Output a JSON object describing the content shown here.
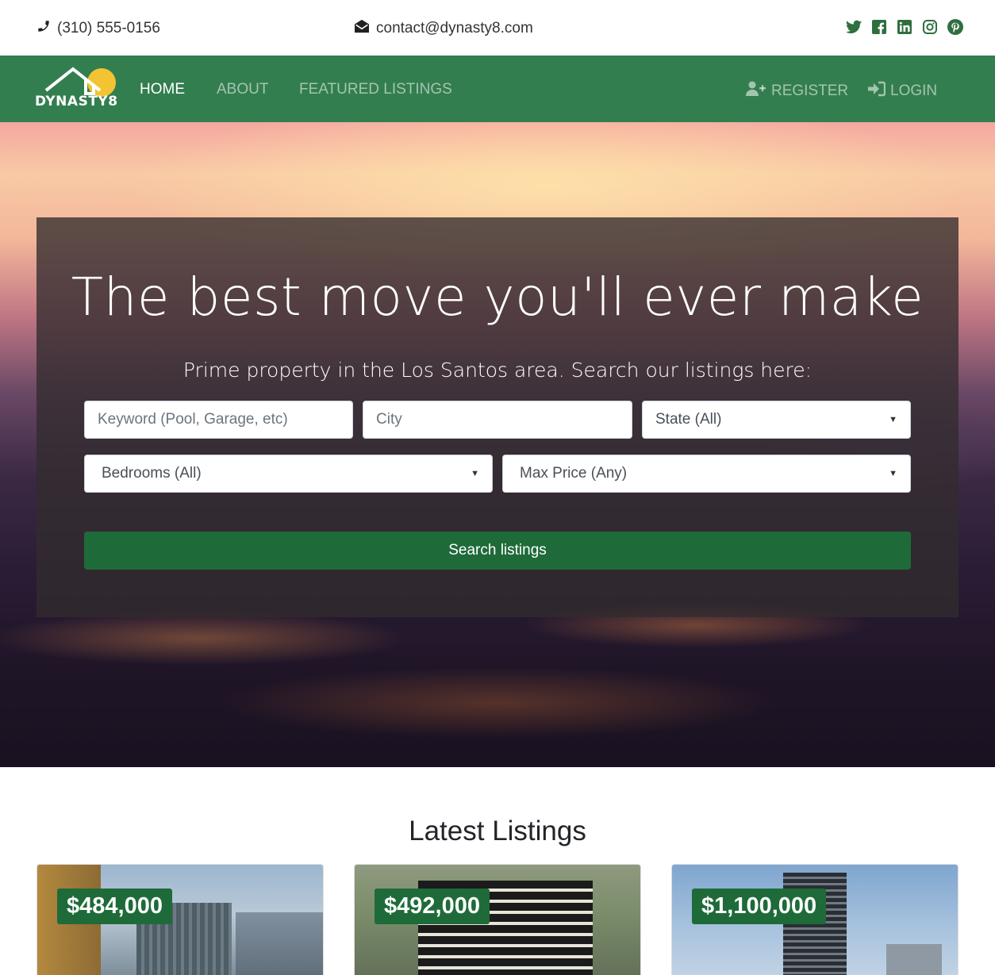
{
  "topbar": {
    "phone": "(310) 555-0156",
    "email": "contact@dynasty8.com",
    "social": [
      "twitter-icon",
      "facebook-icon",
      "linkedin-icon",
      "instagram-icon",
      "pinterest-icon"
    ]
  },
  "navbar": {
    "brand": "DYNASTY8",
    "links": [
      "Home",
      "About",
      "Featured Listings"
    ],
    "register": "Register",
    "login": "Login",
    "bg_color": "#337e4f"
  },
  "hero": {
    "title": "The best move you'll ever make",
    "subtitle": "Prime property in the Los Santos area. Search our listings here:",
    "search": {
      "keyword_placeholder": "Keyword (Pool, Garage, etc)",
      "city_placeholder": "City",
      "state_selected": "State (All)",
      "bedrooms_selected": "Bedrooms (All)",
      "price_selected": "Max Price (Any)",
      "button": "Search listings"
    }
  },
  "listings": {
    "title": "Latest Listings",
    "items": [
      {
        "price": "$484,000"
      },
      {
        "price": "$492,000"
      },
      {
        "price": "$1,100,000"
      }
    ]
  },
  "colors": {
    "accent": "#1e6b39"
  }
}
